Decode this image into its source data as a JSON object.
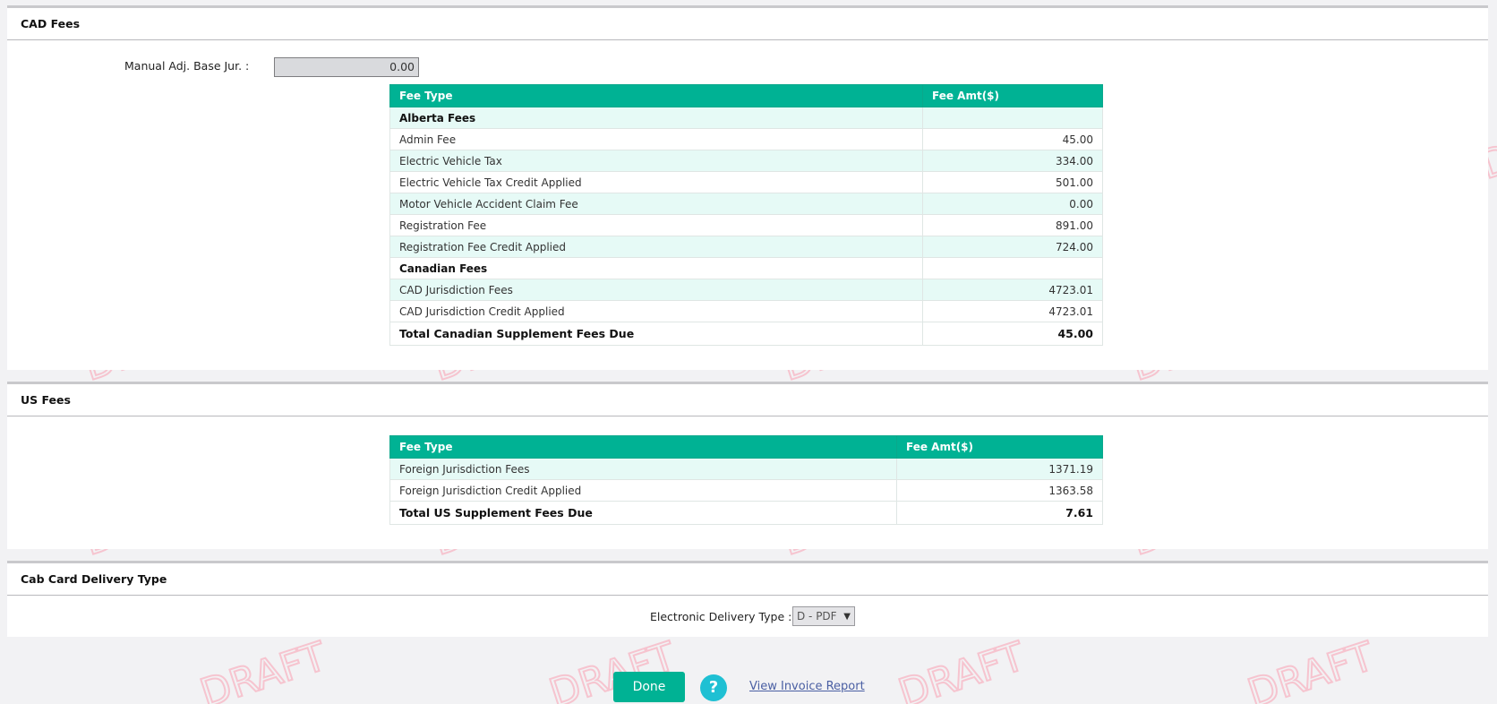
{
  "cad_fees": {
    "title": "CAD Fees",
    "manual_adj_label": "Manual Adj. Base Jur. :",
    "manual_adj_value": "0.00",
    "headers": [
      "Fee Type",
      "Fee Amt($)"
    ],
    "rows": [
      {
        "type": "Alberta Fees",
        "amt": ""
      },
      {
        "type": "Admin Fee",
        "amt": "45.00"
      },
      {
        "type": "Electric Vehicle Tax",
        "amt": "334.00"
      },
      {
        "type": "Electric Vehicle Tax Credit Applied",
        "amt": "501.00"
      },
      {
        "type": "Motor Vehicle Accident Claim Fee",
        "amt": "0.00"
      },
      {
        "type": "Registration Fee",
        "amt": "891.00"
      },
      {
        "type": "Registration Fee Credit Applied",
        "amt": "724.00"
      },
      {
        "type": "Canadian Fees",
        "amt": ""
      },
      {
        "type": "CAD Jurisdiction Fees",
        "amt": "4723.01"
      },
      {
        "type": "CAD Jurisdiction Credit Applied",
        "amt": "4723.01"
      },
      {
        "type": "Total Canadian Supplement Fees Due",
        "amt": "45.00"
      }
    ]
  },
  "us_fees": {
    "title": "US Fees",
    "headers": [
      "Fee Type",
      "Fee Amt($)"
    ],
    "rows": [
      {
        "type": "Foreign Jurisdiction Fees",
        "amt": "1371.19"
      },
      {
        "type": "Foreign Jurisdiction Credit Applied",
        "amt": "1363.58"
      },
      {
        "type": "Total US Supplement Fees Due",
        "amt": "7.61"
      }
    ]
  },
  "cab_card": {
    "title": "Cab Card Delivery Type",
    "delivery_label": "Electronic Delivery Type :",
    "delivery_value": "D - PDF"
  },
  "footer": {
    "done_label": "Done",
    "help_glyph": "?",
    "invoice_link": "View Invoice Report"
  },
  "colors": {
    "accent": "#00b294",
    "row_alt": "#e6faf6",
    "help": "#1fc0d3",
    "watermark": "#f6c4cf"
  },
  "icons": [
    "help-icon",
    "chevron-down-icon"
  ]
}
